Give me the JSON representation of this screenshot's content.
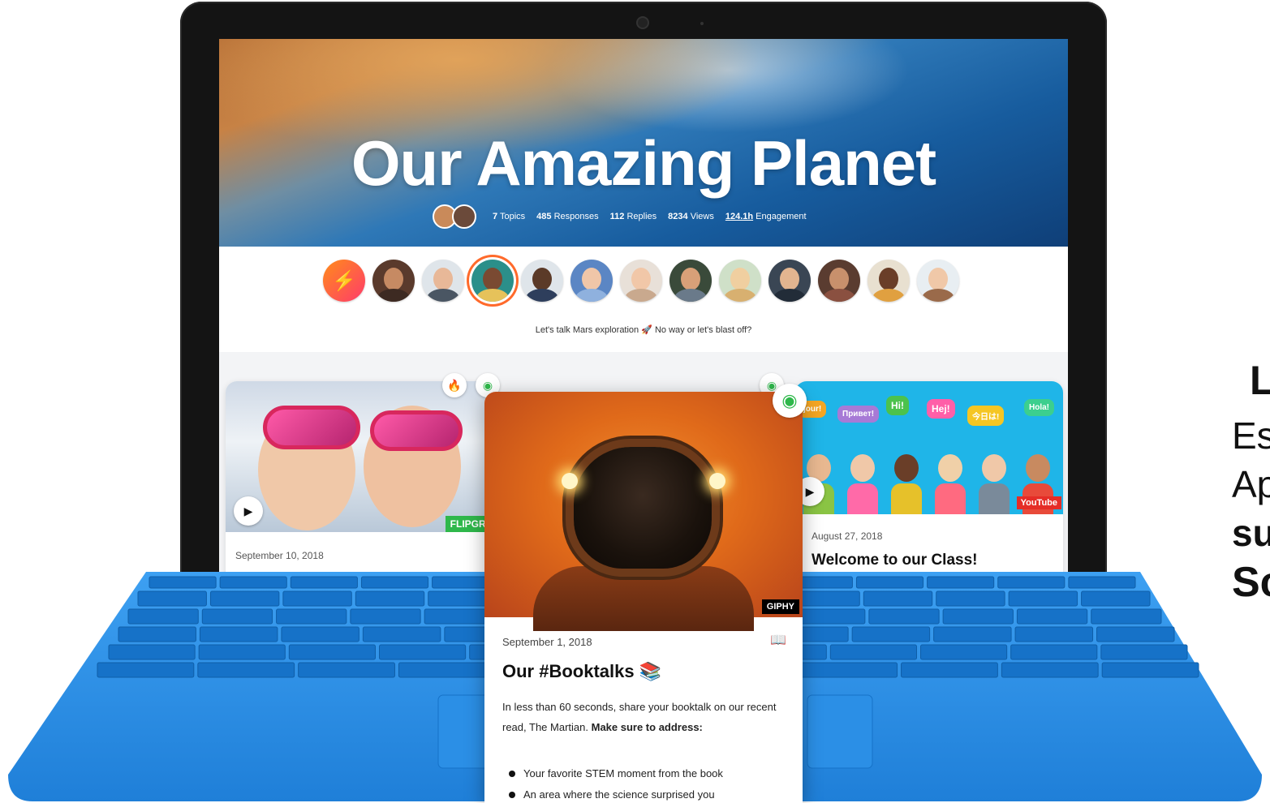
{
  "hero": {
    "title": "Our Amazing Planet",
    "stats": [
      {
        "value": "7",
        "label": "Topics"
      },
      {
        "value": "485",
        "label": "Responses"
      },
      {
        "value": "112",
        "label": "Replies"
      },
      {
        "value": "8234",
        "label": "Views"
      },
      {
        "value": "124.1h",
        "label": "Engagement"
      }
    ]
  },
  "prompt": "Let's talk Mars exploration 🚀 No way or let's blast off?",
  "cards": {
    "left": {
      "date": "September 10, 2018",
      "tag": "FLIPGRI"
    },
    "right": {
      "date": "August 27, 2018",
      "title": "Welcome to our Class!",
      "tag": "YouTube",
      "bubbles": [
        "jour!",
        "Привет!",
        "Hi!",
        "Hej!",
        "今日は!",
        "Hola!"
      ]
    },
    "front": {
      "date": "September 1, 2018",
      "title": "Our #Booktalks 📚",
      "tag": "GIPHY",
      "body_plain": "In less than 60 seconds, share your booktalk on our recent read, The Martian.",
      "body_bold": "Make sure to address:",
      "bullets": [
        "Your favorite STEM moment from the book",
        "An area where the science surprised you"
      ]
    }
  },
  "side_text": {
    "l1": "L",
    "l2": "Es",
    "l3": "Ap",
    "l4": "su",
    "l5": "Sc"
  },
  "colors": {
    "accent": "#ff6a2b",
    "keyboard": "#2b8fe6",
    "flipgrid": "#2fb84b",
    "youtube": "#e52d27"
  }
}
